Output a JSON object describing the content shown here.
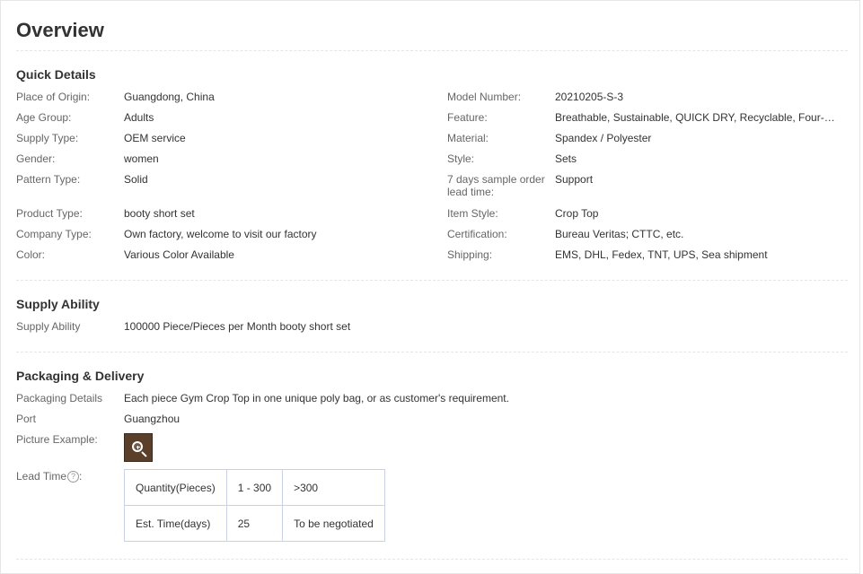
{
  "page_title": "Overview",
  "quick_details": {
    "title": "Quick Details",
    "left": [
      {
        "label": "Place of Origin:",
        "value": "Guangdong, China"
      },
      {
        "label": "Age Group:",
        "value": "Adults"
      },
      {
        "label": "Supply Type:",
        "value": "OEM service"
      },
      {
        "label": "Gender:",
        "value": "women"
      },
      {
        "label": "Pattern Type:",
        "value": "Solid"
      },
      {
        "label": "Product Type:",
        "value": "booty short set"
      },
      {
        "label": "Company Type:",
        "value": "Own factory, welcome to visit our factory"
      },
      {
        "label": "Color:",
        "value": "Various Color Available"
      }
    ],
    "right": [
      {
        "label": "Model Number:",
        "value": "20210205-S-3"
      },
      {
        "label": "Feature:",
        "value": "Breathable, Sustainable, QUICK DRY, Recyclable, Four-Way St..."
      },
      {
        "label": "Material:",
        "value": "Spandex / Polyester"
      },
      {
        "label": "Style:",
        "value": "Sets"
      },
      {
        "label": "7 days sample order lead time:",
        "value": "Support"
      },
      {
        "label": "Item Style:",
        "value": "Crop Top"
      },
      {
        "label": "Certification:",
        "value": "Bureau Veritas; CTTC, etc."
      },
      {
        "label": "Shipping:",
        "value": "EMS, DHL, Fedex, TNT, UPS, Sea shipment"
      }
    ]
  },
  "supply_ability": {
    "title": "Supply Ability",
    "label": "Supply Ability",
    "value": "100000 Piece/Pieces per Month booty short set"
  },
  "packaging": {
    "title": "Packaging & Delivery",
    "details_label": "Packaging Details",
    "details_value": "Each piece Gym Crop Top in one unique poly bag, or as customer's requirement.",
    "port_label": "Port",
    "port_value": "Guangzhou",
    "picture_label": "Picture Example:",
    "lead_time_label": "Lead Time",
    "lead_time_suffix": ":",
    "help_glyph": "?",
    "lead_table": {
      "row1": [
        "Quantity(Pieces)",
        "1 - 300",
        ">300"
      ],
      "row2": [
        "Est. Time(days)",
        "25",
        "To be negotiated"
      ]
    }
  }
}
